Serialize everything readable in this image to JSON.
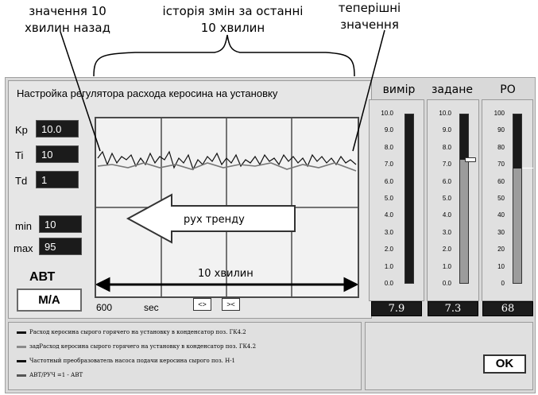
{
  "annotations": {
    "left": "значення 10\nхвилин назад",
    "middle": "історія змін за останні\n10 хвилин",
    "right": "теперішні\nзначення",
    "arrow": "рух тренду",
    "span": "10 хвилин"
  },
  "window": {
    "title": "Настройка регулятора расхода керосина на установку"
  },
  "params": {
    "kp": {
      "label": "Kp",
      "value": "10.0"
    },
    "ti": {
      "label": "Ti",
      "value": "10"
    },
    "td": {
      "label": "Td",
      "value": "1"
    },
    "min": {
      "label": "min",
      "value": "10"
    },
    "max": {
      "label": "max",
      "value": "95"
    }
  },
  "mode": {
    "label": "АВТ",
    "button": "M/A"
  },
  "trend": {
    "x_start": "600",
    "x_unit": "sec",
    "nav_left": "<>",
    "nav_right": "><"
  },
  "columns": {
    "measured": {
      "header": "вимір",
      "ticks": [
        "10.0",
        "9.0",
        "8.0",
        "7.0",
        "6.0",
        "5.0",
        "4.0",
        "3.0",
        "2.0",
        "1.0",
        "0.0"
      ],
      "value": "7.9",
      "level": 0.0
    },
    "setpoint": {
      "header": "задане",
      "ticks": [
        "10.0",
        "9.0",
        "8.0",
        "7.0",
        "6.0",
        "5.0",
        "4.0",
        "3.0",
        "2.0",
        "1.0",
        "0.0"
      ],
      "value": "7.3",
      "level": 0.73
    },
    "output": {
      "header": "РО",
      "ticks": [
        "100",
        "90",
        "80",
        "70",
        "60",
        "50",
        "40",
        "30",
        "20",
        "10",
        "0"
      ],
      "value": "68",
      "level": 0.68
    }
  },
  "legend": [
    {
      "text": "Расход керосина сырого горячего на установку в конденсатор поз. ГК4.2",
      "color": "#111111"
    },
    {
      "text": "задРасход керосина сырого горячего на установку в конденсатор поз. ГК4.2",
      "color": "#8a8a8a"
    },
    {
      "text": "Частотный преобразователь насоса подачи керосина сырого поз. Н-1",
      "color": "#111111"
    },
    {
      "text": "АВТ/РУЧ =1 - АВТ",
      "color": "#555555"
    }
  ],
  "ok_button": "OK",
  "colors": {
    "window_bg": "#d9d9d9",
    "panel_bg": "#e6e6e6",
    "value_box": "#1b1b1b",
    "bar_fill": "#9c9c9c"
  }
}
